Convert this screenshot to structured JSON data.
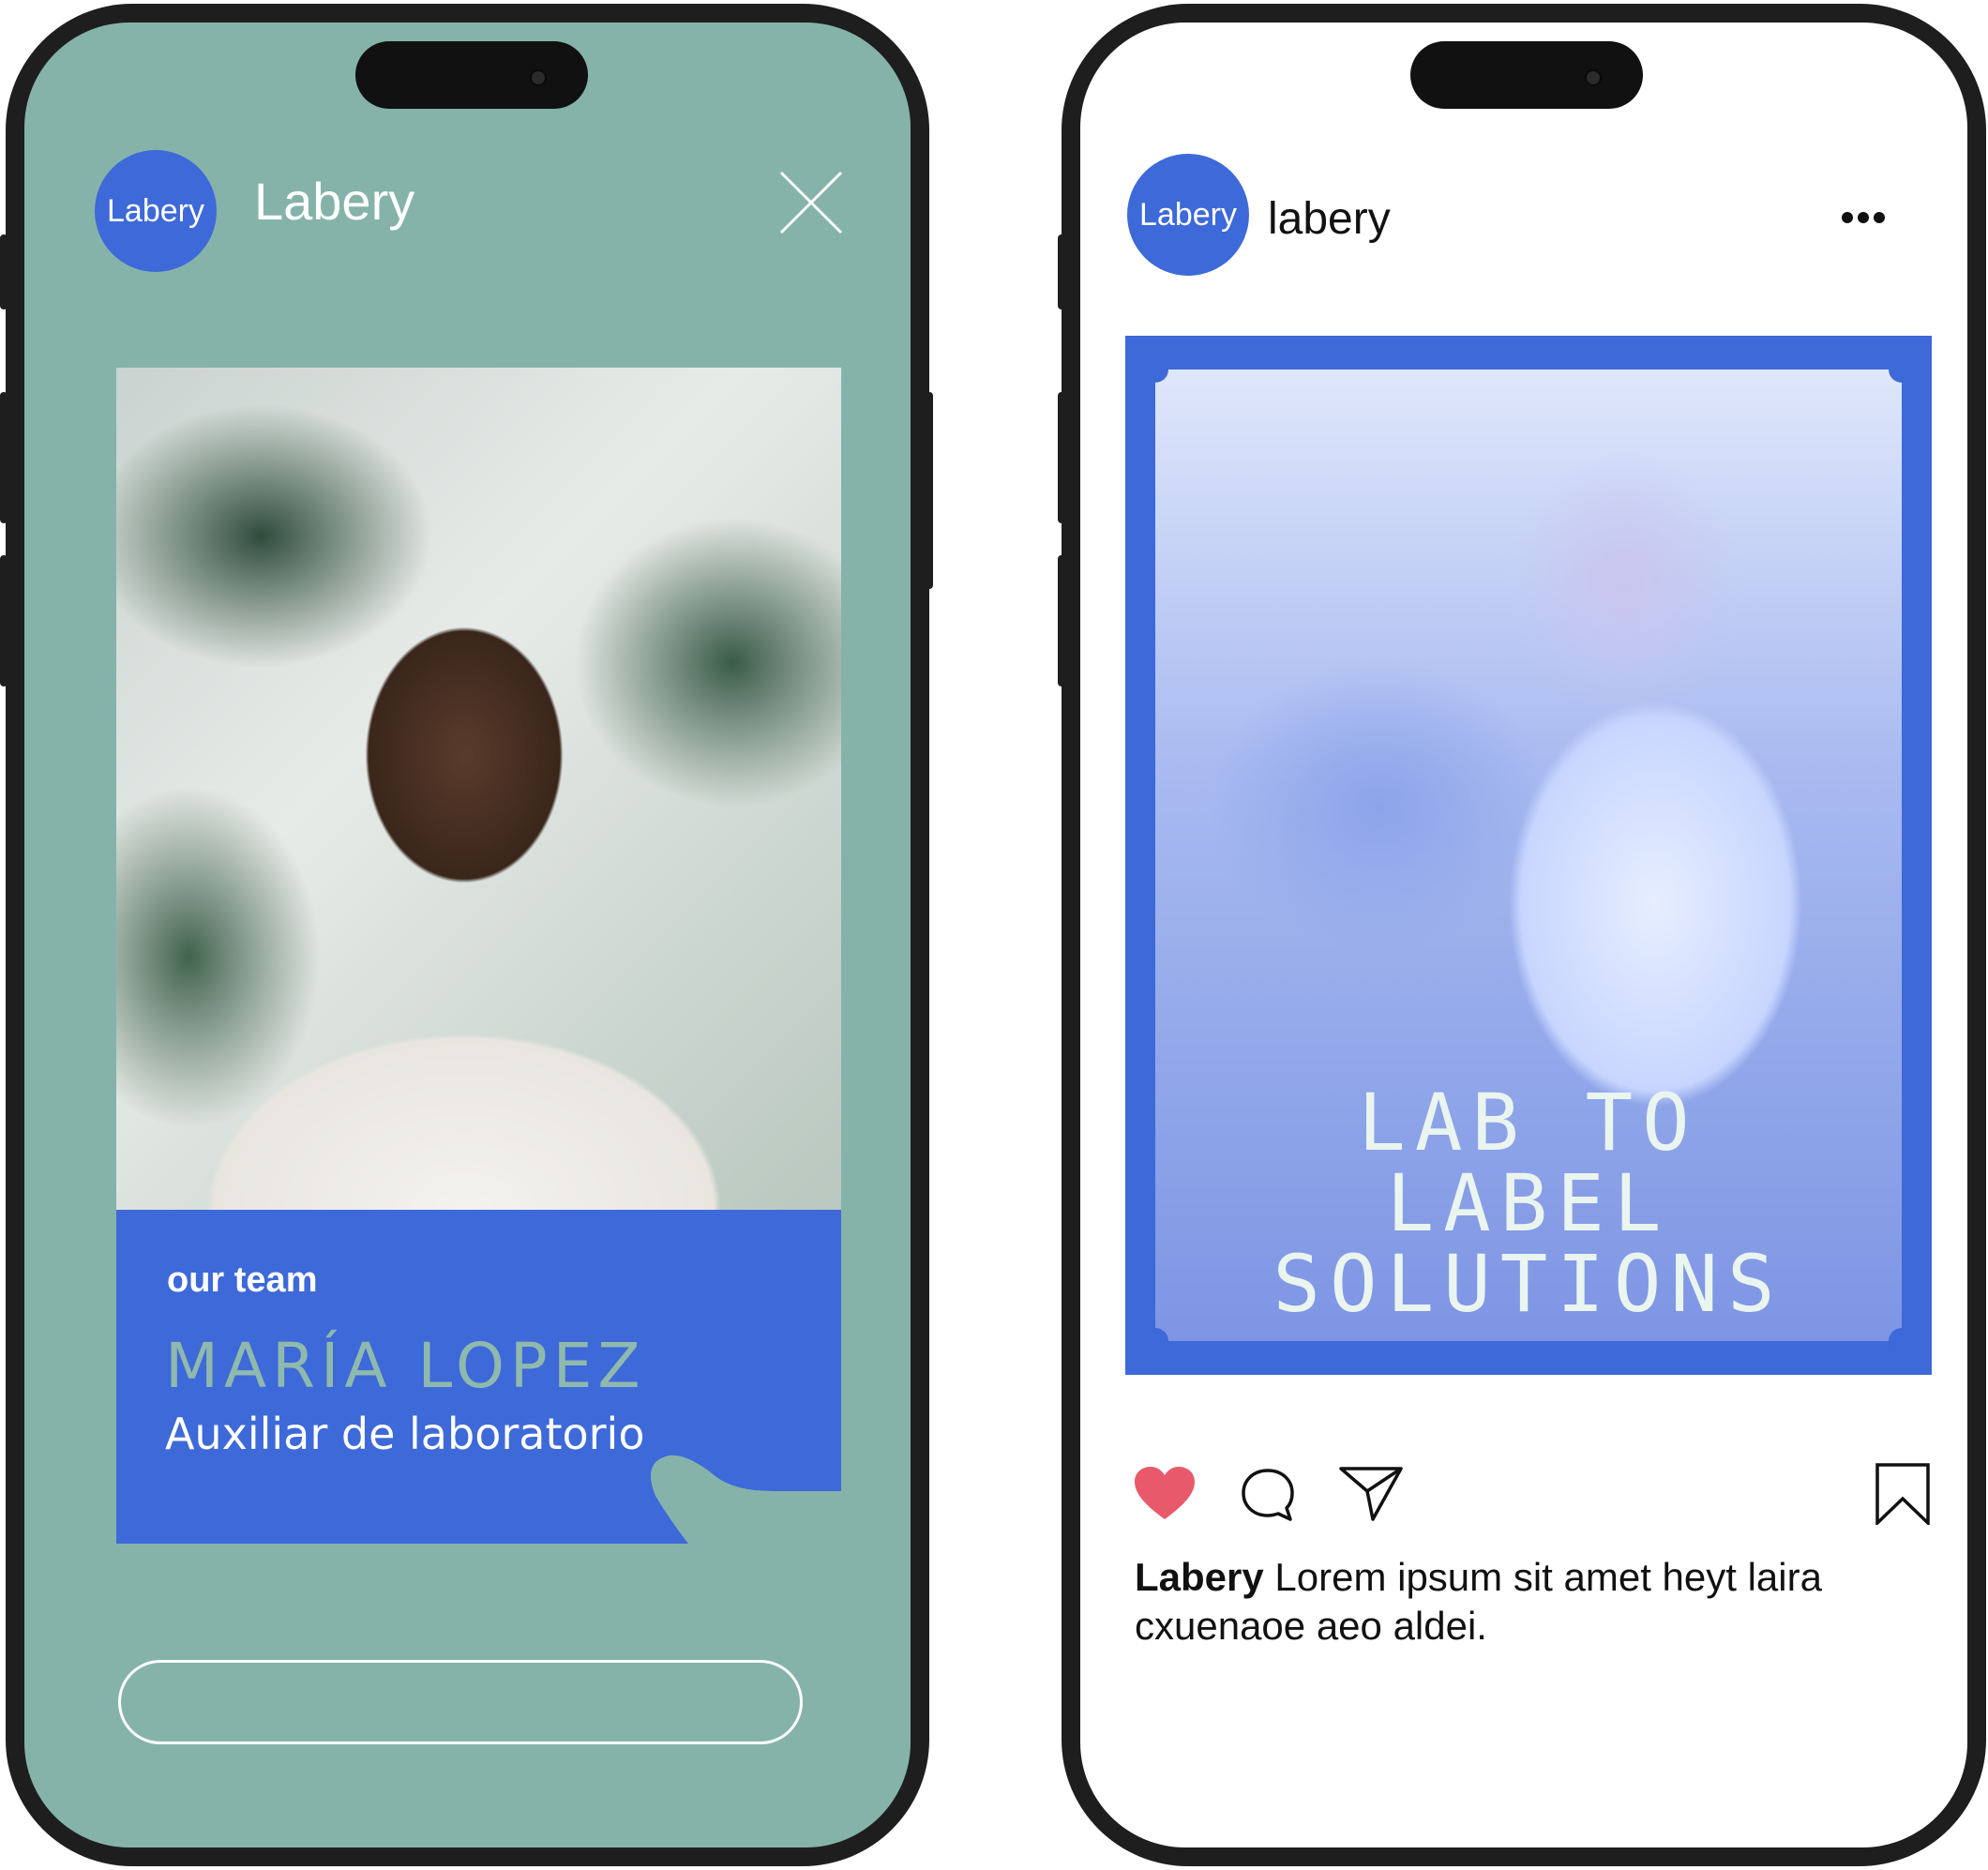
{
  "story": {
    "avatar_text": "Labery",
    "brand_name": "Labery",
    "card": {
      "section_label": "our team",
      "person_name": "MARÍA LOPEZ",
      "person_role": "Auxiliar de laboratorio"
    },
    "icons": {
      "close": "close-icon"
    },
    "colors": {
      "background": "#85b3a9",
      "accent": "#3d69d9",
      "name_text": "#8fb9ad"
    }
  },
  "post": {
    "avatar_text": "Labery",
    "account_name": "labery",
    "headline_lines": [
      "LAB TO",
      "LABEL",
      "SOLUTIONS"
    ],
    "caption_author": "Labery",
    "caption_text": " Lorem ipsum sit amet heyt laira cxuenaoe aeo aldei.",
    "liked": true,
    "icons": {
      "more": "more-options-icon",
      "like": "heart-icon",
      "comment": "comment-icon",
      "share": "send-icon",
      "save": "bookmark-icon"
    },
    "colors": {
      "frame": "#3d69d9",
      "heart": "#e85a6b",
      "headline_text": "#eaf5f0"
    }
  }
}
